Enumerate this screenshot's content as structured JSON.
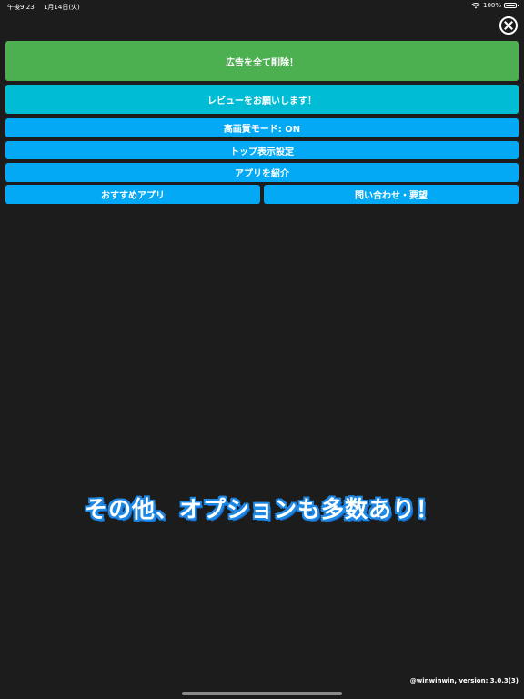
{
  "status_bar": {
    "time": "午後9:23",
    "date": "1月14日(火)",
    "battery_percent": "100%",
    "battery_level": 1.0
  },
  "close_button": {
    "icon": "close-circle-icon"
  },
  "menu": {
    "remove_ads": "広告を全て削除！",
    "review": "レビューをお願いします！",
    "high_quality_mode": "高画質モード: ON",
    "top_display_settings": "トップ表示設定",
    "introduce_apps": "アプリを紹介",
    "recommended_apps": "おすすめアプリ",
    "contact_requests": "問い合わせ・要望"
  },
  "promo_text": "その他、オプションも多数あり！",
  "footer": {
    "version": "@winwinwin, version: 3.0.3(3)"
  },
  "colors": {
    "background": "#1c1c1c",
    "remove_ads_green": "#4caf50",
    "review_cyan": "#00bcd4",
    "menu_blue": "#03a9f4",
    "promo_outline": "#1e88e5"
  }
}
